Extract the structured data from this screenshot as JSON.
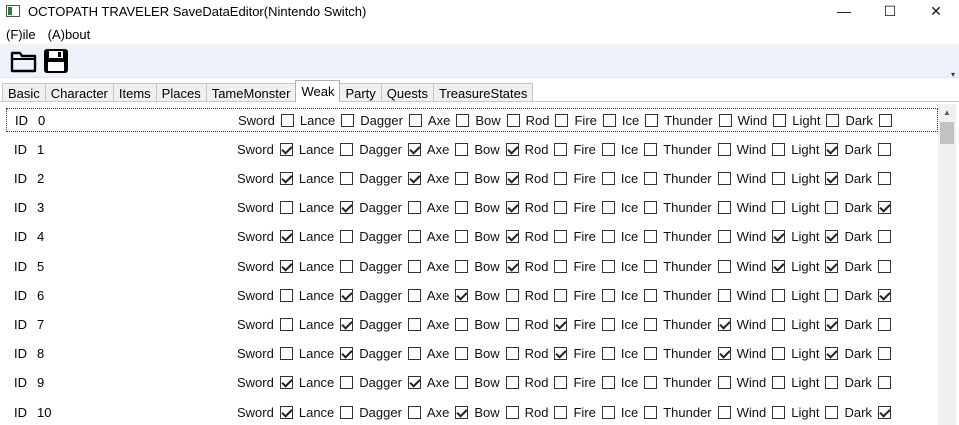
{
  "window": {
    "title": "OCTOPATH TRAVELER SaveDataEditor(Nintendo Switch)",
    "controls": {
      "minimize": "—",
      "maximize": "☐",
      "close": "✕"
    }
  },
  "menu": {
    "file": "(F)ile",
    "about": "(A)bout"
  },
  "toolbar": {
    "open_icon": "folder-open-icon",
    "save_icon": "floppy-save-icon",
    "overflow": "▾"
  },
  "tabs": [
    "Basic",
    "Character",
    "Items",
    "Places",
    "TameMonster",
    "Weak",
    "Party",
    "Quests",
    "TreasureStates"
  ],
  "active_tab": "Weak",
  "weak_columns": [
    "Sword",
    "Lance",
    "Dagger",
    "Axe",
    "Bow",
    "Rod",
    "Fire",
    "Ice",
    "Thunder",
    "Wind",
    "Light",
    "Dark"
  ],
  "id_label": "ID",
  "rows": [
    {
      "id": "0",
      "weak": [
        false,
        false,
        false,
        false,
        false,
        false,
        false,
        false,
        false,
        false,
        false,
        false
      ]
    },
    {
      "id": "1",
      "weak": [
        true,
        false,
        true,
        false,
        true,
        false,
        false,
        false,
        false,
        false,
        true,
        false
      ]
    },
    {
      "id": "2",
      "weak": [
        true,
        false,
        true,
        false,
        true,
        false,
        false,
        false,
        false,
        false,
        true,
        false
      ]
    },
    {
      "id": "3",
      "weak": [
        false,
        true,
        false,
        false,
        true,
        false,
        false,
        false,
        false,
        false,
        false,
        true
      ]
    },
    {
      "id": "4",
      "weak": [
        true,
        false,
        false,
        false,
        true,
        false,
        false,
        false,
        false,
        true,
        true,
        false
      ]
    },
    {
      "id": "5",
      "weak": [
        true,
        false,
        false,
        false,
        true,
        false,
        false,
        false,
        false,
        true,
        true,
        false
      ]
    },
    {
      "id": "6",
      "weak": [
        false,
        true,
        false,
        true,
        false,
        false,
        false,
        false,
        false,
        false,
        false,
        true
      ]
    },
    {
      "id": "7",
      "weak": [
        false,
        true,
        false,
        false,
        false,
        true,
        false,
        false,
        true,
        false,
        true,
        false
      ]
    },
    {
      "id": "8",
      "weak": [
        false,
        true,
        false,
        false,
        false,
        true,
        false,
        false,
        true,
        false,
        true,
        false
      ]
    },
    {
      "id": "9",
      "weak": [
        true,
        false,
        true,
        false,
        false,
        false,
        false,
        false,
        false,
        false,
        false,
        false
      ]
    },
    {
      "id": "10",
      "weak": [
        true,
        false,
        false,
        true,
        false,
        false,
        false,
        false,
        false,
        false,
        false,
        true
      ]
    }
  ]
}
